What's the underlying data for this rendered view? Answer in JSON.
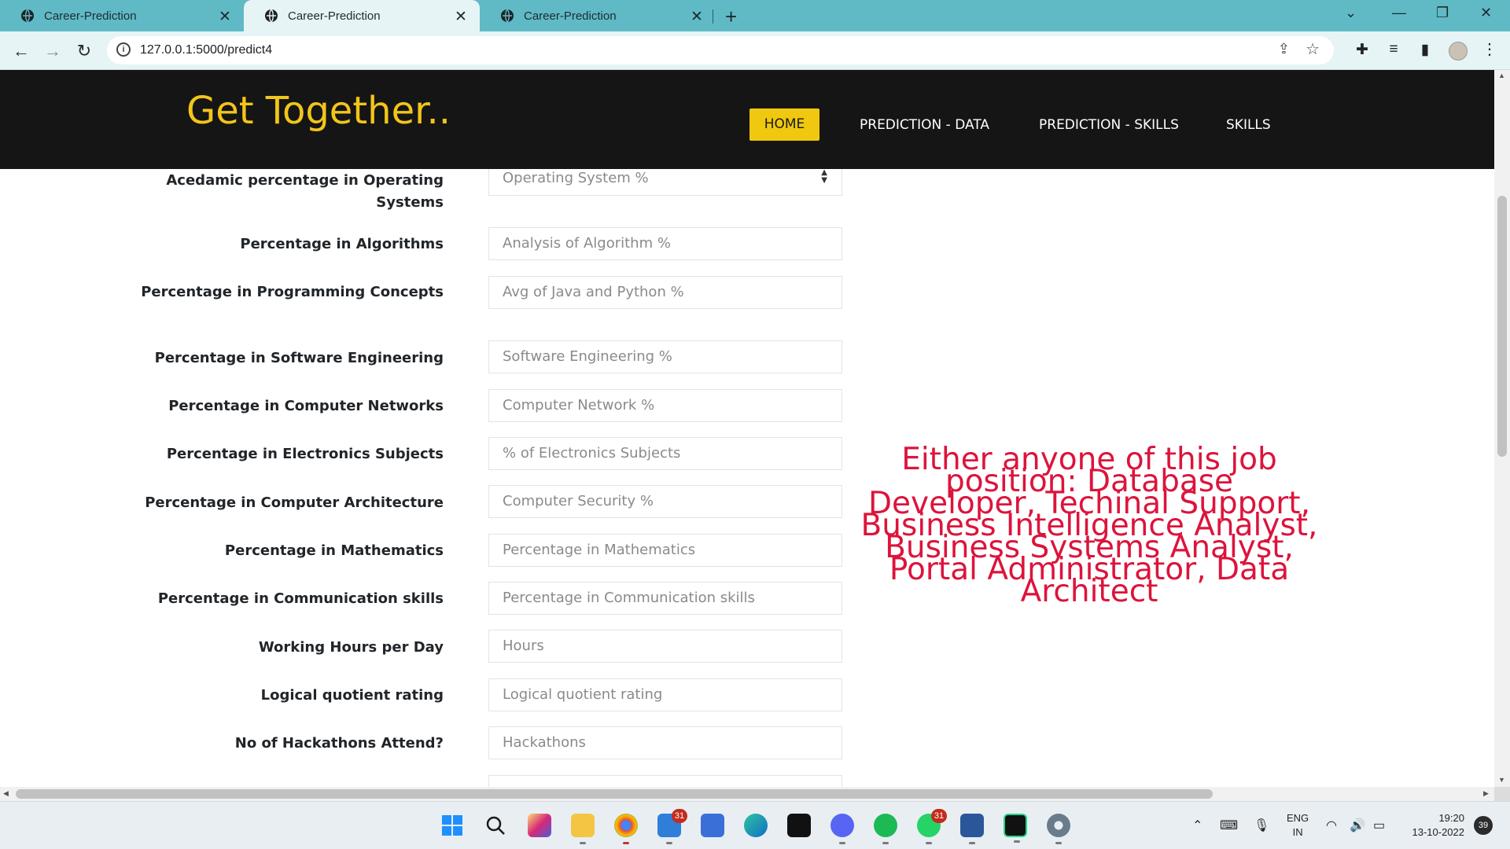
{
  "browser": {
    "tabs": [
      {
        "title": "Career-Prediction"
      },
      {
        "title": "Career-Prediction"
      },
      {
        "title": "Career-Prediction"
      }
    ],
    "address": "127.0.0.1:5000/predict4"
  },
  "site": {
    "logo": "Get Together..",
    "nav": {
      "home": "HOME",
      "prediction_data": "PREDICTION - DATA",
      "prediction_skills": "PREDICTION - SKILLS",
      "skills": "SKILLS"
    },
    "accent_color": "#f0c810",
    "result_color": "#dc143c"
  },
  "form": {
    "fields": [
      {
        "label": "Acedamic percentage in Operating Systems",
        "placeholder": "Operating System %"
      },
      {
        "label": "Percentage in Algorithms",
        "placeholder": "Analysis of Algorithm %"
      },
      {
        "label": "Percentage in Programming Concepts",
        "placeholder": "Avg of Java and Python %"
      },
      {
        "label": "Percentage in Software Engineering",
        "placeholder": "Software Engineering %"
      },
      {
        "label": "Percentage in Computer Networks",
        "placeholder": "Computer Network %"
      },
      {
        "label": "Percentage in Electronics Subjects",
        "placeholder": "% of Electronics Subjects"
      },
      {
        "label": "Percentage in Computer Architecture",
        "placeholder": "Computer Security %"
      },
      {
        "label": "Percentage in Mathematics",
        "placeholder": "Percentage in Mathematics"
      },
      {
        "label": "Percentage in Communication skills",
        "placeholder": "Percentage in Communication skills"
      },
      {
        "label": "Working Hours per Day",
        "placeholder": "Hours"
      },
      {
        "label": "Logical quotient rating",
        "placeholder": "Logical quotient rating"
      },
      {
        "label": "No of Hackathons Attend?",
        "placeholder": "Hackathons"
      }
    ]
  },
  "result": {
    "text": "Either anyone of this job position: Database Developer, Techinal Support, Business Intelligence Analyst, Business Systems Analyst, Portal Administrator, Data Architect"
  },
  "taskbar": {
    "mail_badge": "31",
    "whatsapp_badge": "31",
    "lang_line1": "ENG",
    "lang_line2": "IN",
    "time": "19:20",
    "date": "13-10-2022",
    "notifications": "39"
  }
}
